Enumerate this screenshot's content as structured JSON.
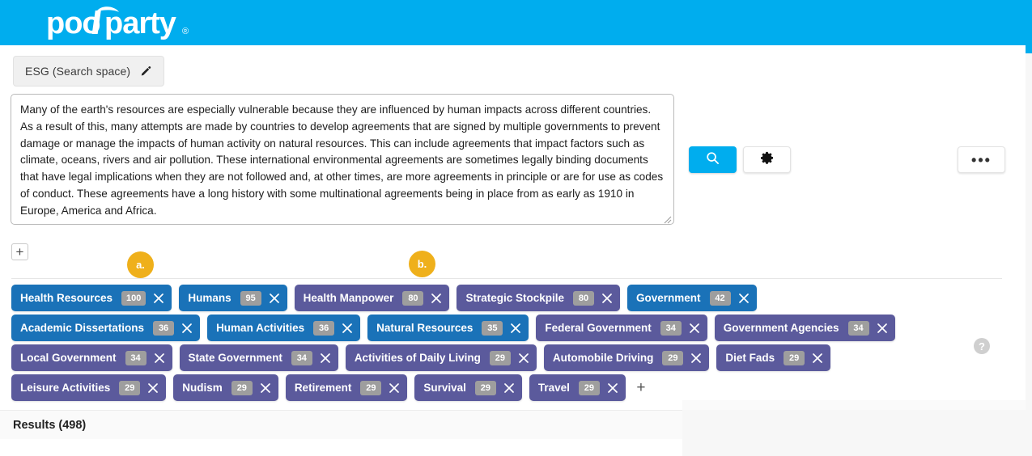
{
  "header": {
    "logo_text": "poolparty",
    "logo_registered": "®",
    "brand_color": "#00ADEE"
  },
  "search_space": {
    "label": "ESG (Search space)",
    "edit_icon": "pencil-icon"
  },
  "query": {
    "text": "Many of the earth's resources are especially vulnerable because they are influenced by human impacts across different countries. As a result of this, many attempts are made by countries to develop agreements that are signed by multiple governments to prevent damage or manage the impacts of human activity on natural resources. This can include agreements that impact factors such as climate, oceans, rivers and air pollution. These international environmental agreements are sometimes legally binding documents that have legal implications when they are not followed and, at other times, are more agreements in principle or are for use as codes of conduct. These agreements have a long history with some multinational agreements being in place from as early as 1910 in Europe, America and Africa.",
    "placeholder": ""
  },
  "actions": {
    "search_icon": "search-icon",
    "settings_icon": "gear-icon",
    "more_label": "•••",
    "add_small_label": "+"
  },
  "annotations": [
    {
      "id": "a",
      "label": "a.",
      "color": "#EFB01B"
    },
    {
      "id": "b",
      "label": "b.",
      "color": "#EFB01B"
    }
  ],
  "tags": {
    "add_label": "+",
    "close_icon": "close-icon",
    "colors": {
      "blue": "#1A72B8",
      "purple": "#5B5A9C",
      "count_badge": "#9E9E9E"
    },
    "rows": [
      [
        {
          "label": "Health Resources",
          "count": "100",
          "color": "blue"
        },
        {
          "label": "Humans",
          "count": "95",
          "color": "blue"
        },
        {
          "label": "Health Manpower",
          "count": "80",
          "color": "purple"
        },
        {
          "label": "Strategic Stockpile",
          "count": "80",
          "color": "purple"
        },
        {
          "label": "Government",
          "count": "42",
          "color": "blue"
        }
      ],
      [
        {
          "label": "Academic Dissertations",
          "count": "36",
          "color": "blue"
        },
        {
          "label": "Human Activities",
          "count": "36",
          "color": "blue"
        },
        {
          "label": "Natural Resources",
          "count": "35",
          "color": "blue"
        },
        {
          "label": "Federal Government",
          "count": "34",
          "color": "purple"
        },
        {
          "label": "Government Agencies",
          "count": "34",
          "color": "purple"
        }
      ],
      [
        {
          "label": "Local Government",
          "count": "34",
          "color": "purple"
        },
        {
          "label": "State Government",
          "count": "34",
          "color": "purple"
        },
        {
          "label": "Activities of Daily Living",
          "count": "29",
          "color": "purple"
        },
        {
          "label": "Automobile Driving",
          "count": "29",
          "color": "purple"
        },
        {
          "label": "Diet Fads",
          "count": "29",
          "color": "purple"
        }
      ],
      [
        {
          "label": "Leisure Activities",
          "count": "29",
          "color": "purple"
        },
        {
          "label": "Nudism",
          "count": "29",
          "color": "purple"
        },
        {
          "label": "Retirement",
          "count": "29",
          "color": "purple"
        },
        {
          "label": "Survival",
          "count": "29",
          "color": "purple"
        },
        {
          "label": "Travel",
          "count": "29",
          "color": "purple"
        }
      ]
    ]
  },
  "help": {
    "label": "?"
  },
  "results": {
    "title": "Results (498)"
  }
}
